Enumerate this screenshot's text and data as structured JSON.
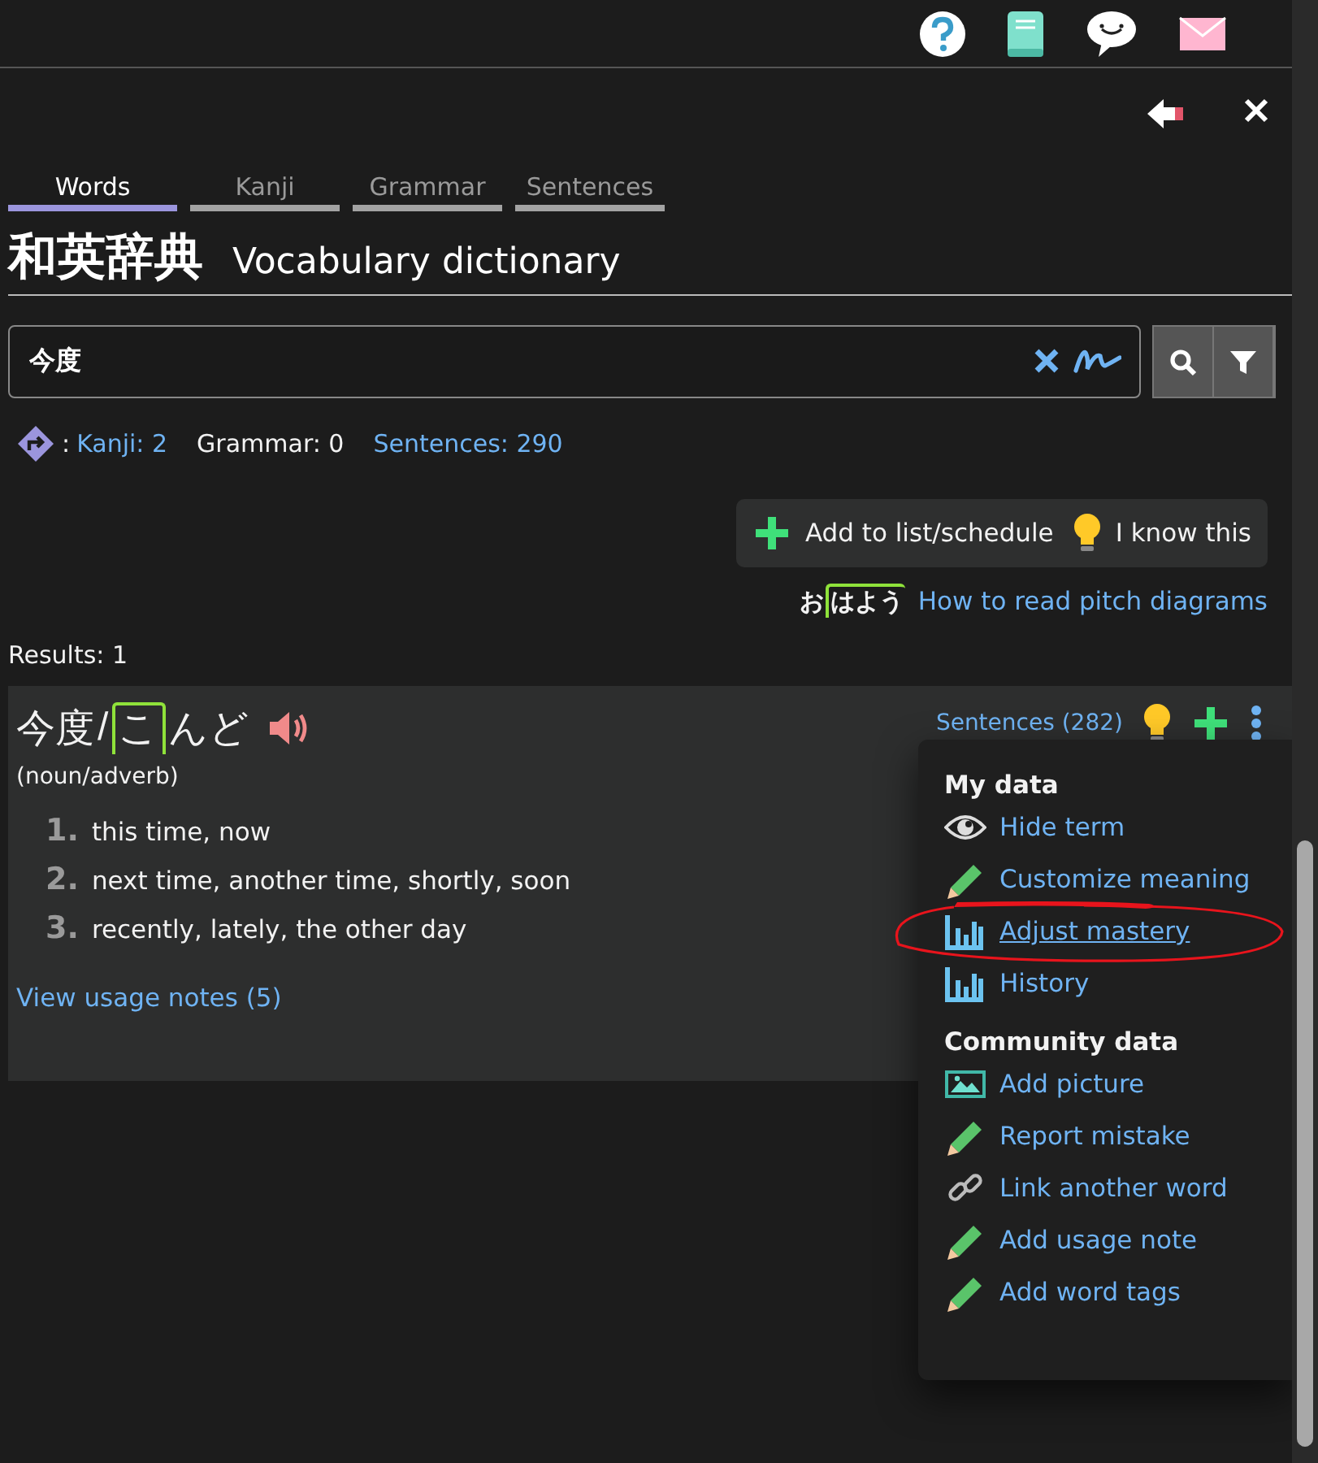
{
  "tabs": [
    {
      "label": "Words",
      "selected": true
    },
    {
      "label": "Kanji",
      "selected": false
    },
    {
      "label": "Grammar",
      "selected": false
    },
    {
      "label": "Sentences",
      "selected": false
    }
  ],
  "title": {
    "japanese": "和英辞典",
    "english": "Vocabulary dictionary"
  },
  "search": {
    "value": "今度"
  },
  "related": {
    "prefix": ":",
    "items": [
      {
        "label": "Kanji: 2",
        "link": true
      },
      {
        "label": "Grammar: 0",
        "link": false
      },
      {
        "label": "Sentences: 290",
        "link": true
      }
    ]
  },
  "actions": [
    {
      "kind": "plus",
      "label": "Add to list/schedule"
    },
    {
      "kind": "bulb",
      "label": "I know this"
    }
  ],
  "pitch_help": {
    "example": [
      {
        "text": "お",
        "high": false
      },
      {
        "text": "はよう",
        "high": true
      }
    ],
    "link": "How to read pitch diagrams"
  },
  "results_label": "Results: 1",
  "entry": {
    "word": "今度",
    "separator": "/",
    "reading": [
      {
        "text": "こ",
        "high": true
      },
      {
        "text": "んど",
        "high": false
      }
    ],
    "pos": "(noun/adverb)",
    "meanings": [
      {
        "number": "1.",
        "text": "this time, now"
      },
      {
        "number": "2.",
        "text": "next time, another time, shortly, soon"
      },
      {
        "number": "3.",
        "text": "recently, lately, the other day"
      }
    ],
    "usage_link": "View usage notes (5)",
    "sentences_link": "Sentences (282)"
  },
  "menu": {
    "sections": [
      {
        "title": "My data",
        "items": [
          {
            "kind": "eye",
            "label": "Hide term",
            "hovered": false
          },
          {
            "kind": "pencil",
            "label": "Customize meaning",
            "hovered": false
          },
          {
            "kind": "chart",
            "label": "Adjust mastery",
            "hovered": true
          },
          {
            "kind": "chart",
            "label": "History",
            "hovered": false
          }
        ]
      },
      {
        "title": "Community data",
        "items": [
          {
            "kind": "picture",
            "label": "Add picture",
            "hovered": false
          },
          {
            "kind": "pencil",
            "label": "Report mistake",
            "hovered": false
          },
          {
            "kind": "link",
            "label": "Link another word",
            "hovered": false
          },
          {
            "kind": "pencil",
            "label": "Add usage note",
            "hovered": false
          },
          {
            "kind": "pencil",
            "label": "Add word tags",
            "hovered": false
          }
        ]
      }
    ]
  }
}
